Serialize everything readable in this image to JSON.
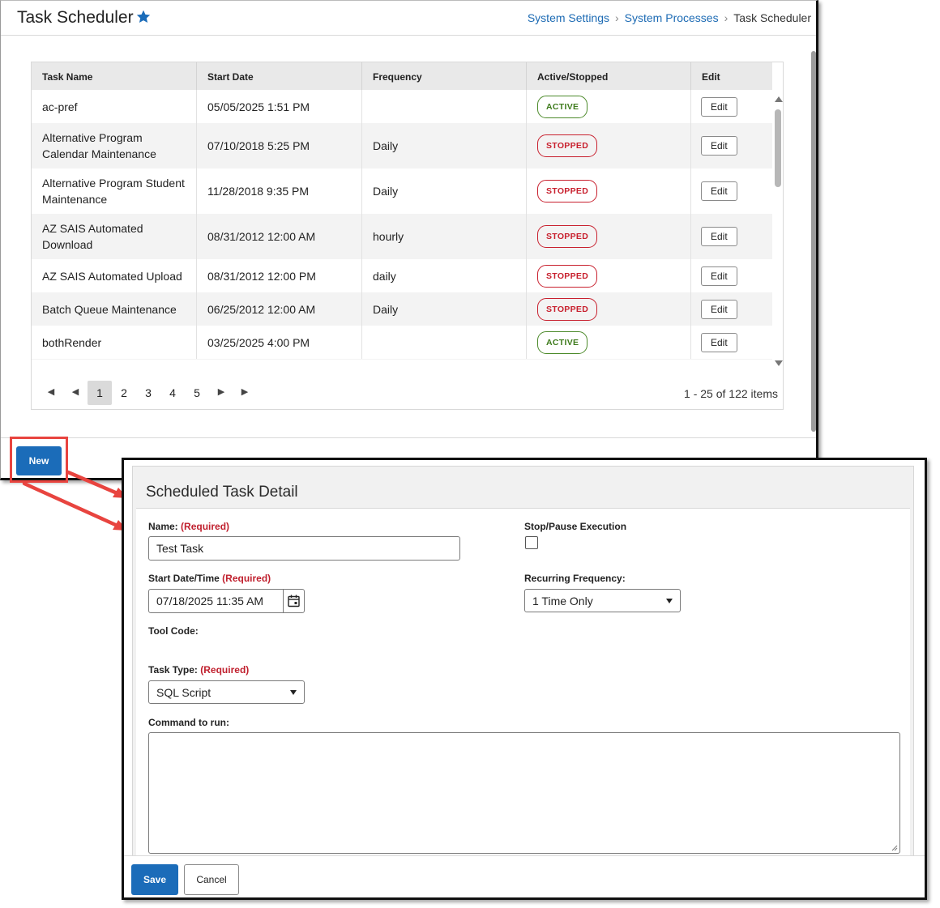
{
  "header": {
    "title": "Task Scheduler",
    "breadcrumb": [
      "System Settings",
      "System Processes",
      "Task Scheduler"
    ]
  },
  "grid": {
    "columns": [
      "Task Name",
      "Start Date",
      "Frequency",
      "Active/Stopped",
      "Edit"
    ],
    "edit_label": "Edit",
    "rows": [
      {
        "name": "ac-pref",
        "start": "05/05/2025 1:51 PM",
        "frequency": "",
        "status": "ACTIVE"
      },
      {
        "name": "Alternative Program Calendar Maintenance",
        "start": "07/10/2018 5:25 PM",
        "frequency": "Daily",
        "status": "STOPPED"
      },
      {
        "name": "Alternative Program Student Maintenance",
        "start": "11/28/2018 9:35 PM",
        "frequency": "Daily",
        "status": "STOPPED"
      },
      {
        "name": "AZ SAIS Automated Download",
        "start": "08/31/2012 12:00 AM",
        "frequency": "hourly",
        "status": "STOPPED"
      },
      {
        "name": "AZ SAIS Automated Upload",
        "start": "08/31/2012 12:00 PM",
        "frequency": "daily",
        "status": "STOPPED"
      },
      {
        "name": "Batch Queue Maintenance",
        "start": "06/25/2012 12:00 AM",
        "frequency": "Daily",
        "status": "STOPPED"
      },
      {
        "name": "bothRender",
        "start": "03/25/2025 4:00 PM",
        "frequency": "",
        "status": "ACTIVE"
      }
    ]
  },
  "pager": {
    "pages": [
      "1",
      "2",
      "3",
      "4",
      "5"
    ],
    "current": "1",
    "info": "1 - 25 of 122 items"
  },
  "new_button": "New",
  "detail": {
    "title": "Scheduled Task Detail",
    "required_text": "(Required)",
    "name_label": "Name:",
    "name_value": "Test Task",
    "stop_label": "Stop/Pause Execution",
    "start_label": "Start Date/Time",
    "start_value": "07/18/2025 11:35 AM",
    "recurring_label": "Recurring Frequency:",
    "recurring_value": "1 Time Only",
    "tool_code_label": "Tool Code:",
    "task_type_label": "Task Type:",
    "task_type_value": "SQL Script",
    "command_label": "Command to run:",
    "save_label": "Save",
    "cancel_label": "Cancel"
  },
  "colors": {
    "primary": "#1b6cb9",
    "link": "#1d6bb4",
    "active": "#4c8a2a",
    "stopped": "#c8202e",
    "highlight": "#e8443f"
  }
}
